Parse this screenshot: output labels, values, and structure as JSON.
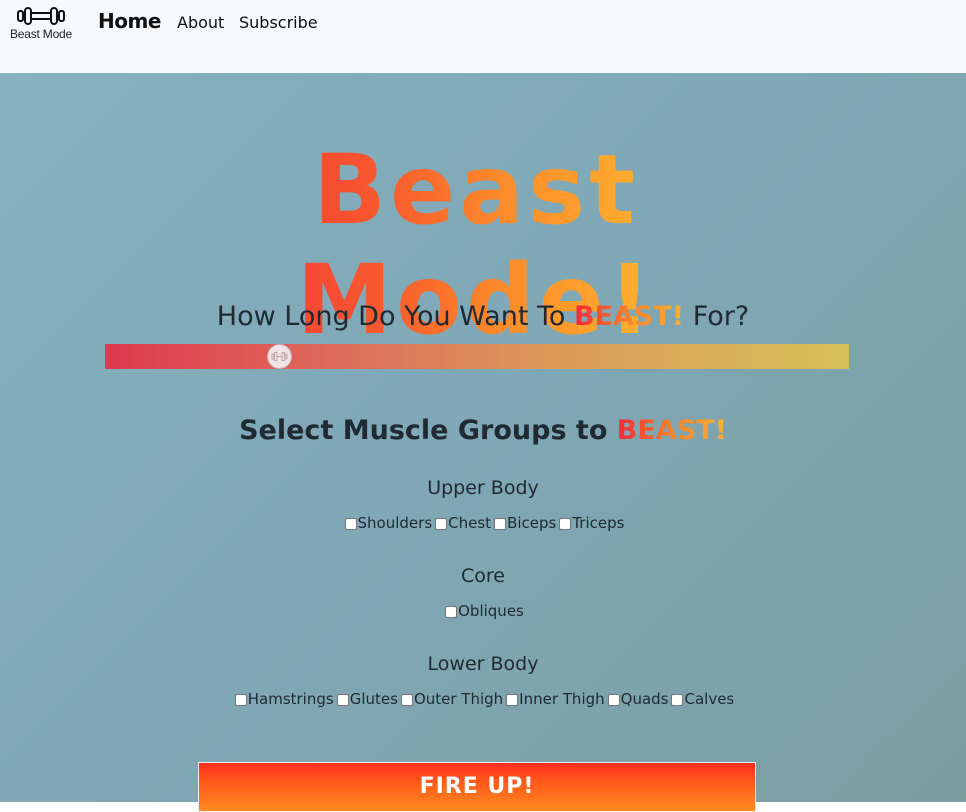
{
  "nav": {
    "logo_text": "Beast Mode",
    "home": "Home",
    "about": "About",
    "subscribe": "Subscribe"
  },
  "hero": {
    "title": "Beast Mode!"
  },
  "duration": {
    "prefix": "How Long Do You Want To ",
    "beast": "BEAST!",
    "suffix": " For?",
    "slider_fraction": 0.226
  },
  "muscle": {
    "prefix": "Select Muscle Groups to ",
    "beast": "BEAST!"
  },
  "groups": {
    "upper": {
      "title": "Upper Body",
      "options": [
        "Shoulders",
        "Chest",
        "Biceps",
        "Triceps"
      ]
    },
    "core": {
      "title": "Core",
      "options": [
        "Obliques"
      ]
    },
    "lower": {
      "title": "Lower Body",
      "options": [
        "Hamstrings",
        "Glutes",
        "Outer Thigh",
        "Inner Thigh",
        "Quads",
        "Calves"
      ]
    }
  },
  "fire_button": "FIRE UP!",
  "icons": {
    "logo": "dumbbell-icon",
    "slider_thumb": "dumbbell-icon"
  }
}
